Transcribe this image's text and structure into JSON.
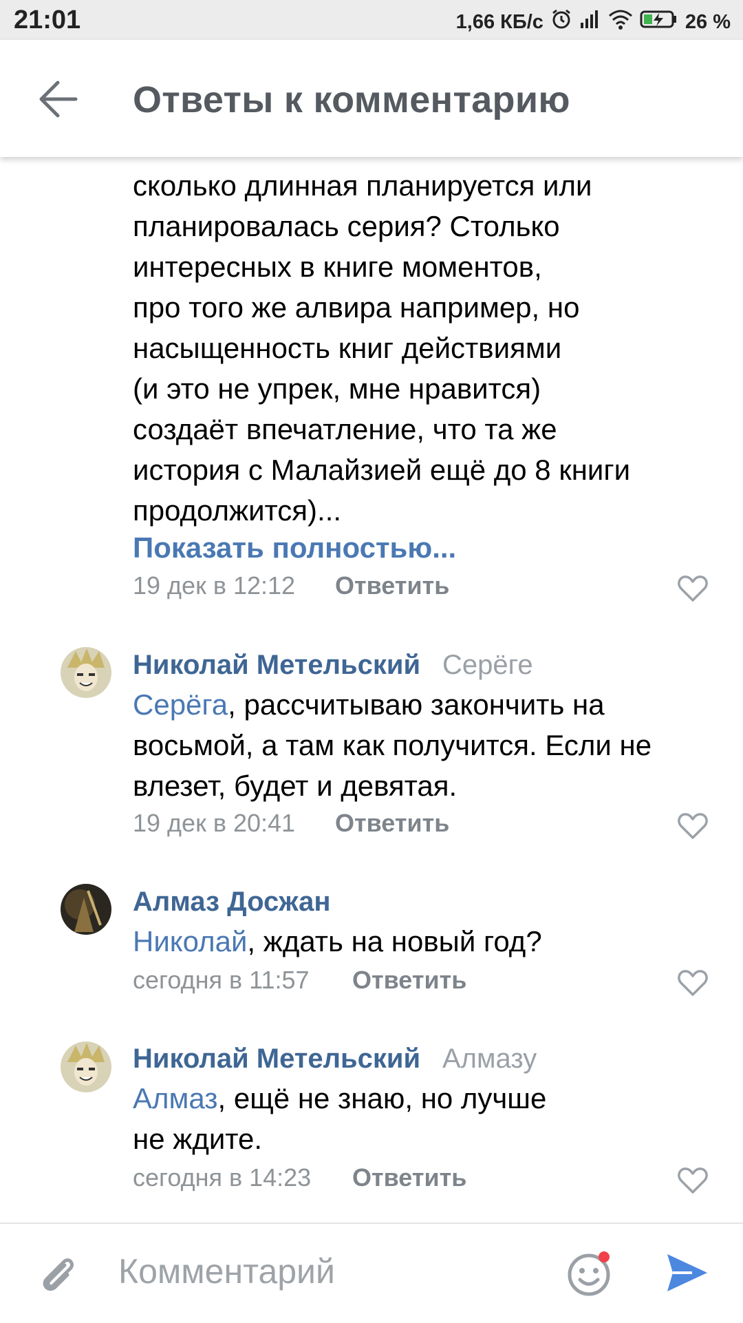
{
  "status_bar": {
    "time": "21:01",
    "speed": "1,66 КБ/с",
    "battery": "26 %",
    "icons": [
      "alarm-icon",
      "signal-icon",
      "wifi-icon",
      "battery-charging-icon"
    ]
  },
  "header": {
    "title": "Ответы к комментарию",
    "back_icon": "arrow-left-icon"
  },
  "first_comment": {
    "text_lines": [
      "сколько длинная планируется или",
      "планировалась серия? Столько",
      "интересных в книге моментов,",
      "про того же алвира например, но",
      "насыщенность книг действиями",
      "(и это не упрек, мне нравится)",
      "создаёт впечатление, что та же",
      "история с Малайзией ещё до 8 книги",
      "продолжится)..."
    ],
    "show_more": "Показать полностью...",
    "time": "19 дек в 12:12",
    "reply": "Ответить"
  },
  "comments": [
    {
      "author": "Николай Метельский",
      "addressee": "Серёге",
      "mention": "Серёга",
      "text_line1": ", рассчитываю закончить на",
      "text_line2": "восьмой, а там как получится. Если не",
      "text_line3": "влезет, будет и девятая.",
      "time": "19 дек в 20:41",
      "reply": "Ответить"
    },
    {
      "author": "Алмаз Досжан",
      "addressee": "",
      "mention": "Николай",
      "text_line1": ", ждать на новый год?",
      "time": "сегодня в 11:57",
      "reply": "Ответить"
    },
    {
      "author": "Николай Метельский",
      "addressee": "Алмазу",
      "mention": "Алмаз",
      "text_line1": ", ещё не знаю, но лучше",
      "text_line2": "не ждите.",
      "time": "сегодня в 14:23",
      "reply": "Ответить"
    }
  ],
  "composer": {
    "placeholder": "Комментарий",
    "attach_icon": "paperclip-icon",
    "emoji_icon": "smiley-icon",
    "send_icon": "send-icon"
  },
  "colors": {
    "link": "#4a78b3",
    "author": "#3f6694",
    "meta": "#8e9397",
    "send": "#4c87e0",
    "badge": "#f0414a"
  }
}
